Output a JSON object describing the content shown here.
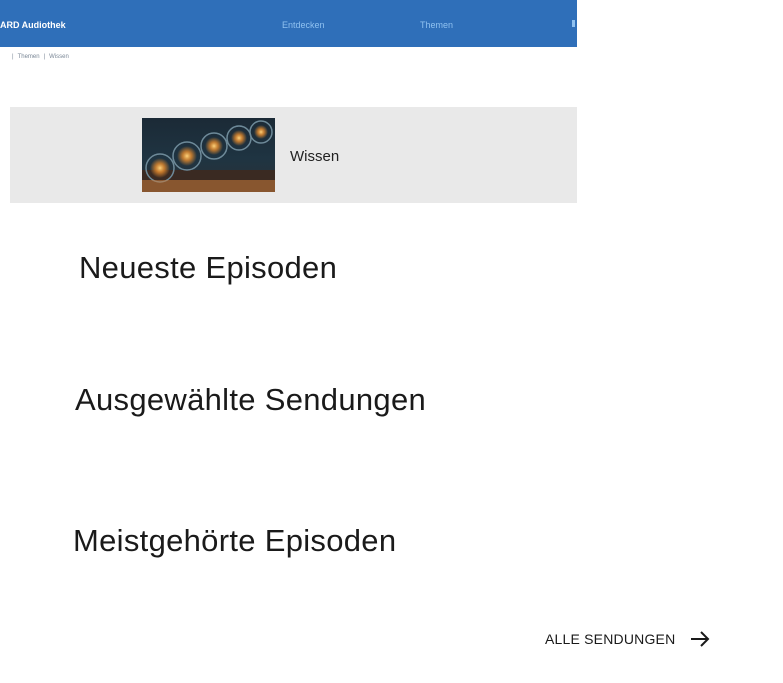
{
  "header": {
    "brand": "ARD Audiothek",
    "nav": [
      "Entdecken",
      "Themen"
    ]
  },
  "breadcrumb": [
    "Themen",
    "Wissen"
  ],
  "hero": {
    "title": "Wissen"
  },
  "sections": [
    "Neueste Episoden",
    "Ausgewählte Sendungen",
    "Meistgehörte Episoden"
  ],
  "all_shows_button": "ALLE SENDUNGEN",
  "colors": {
    "header_bg": "#2f6fb9",
    "nav_link": "#8fc1f0",
    "hero_bg": "#e9e9e9"
  },
  "icons": {
    "arrow": "arrow-right-icon",
    "hero_image": "light-bulbs-image"
  }
}
